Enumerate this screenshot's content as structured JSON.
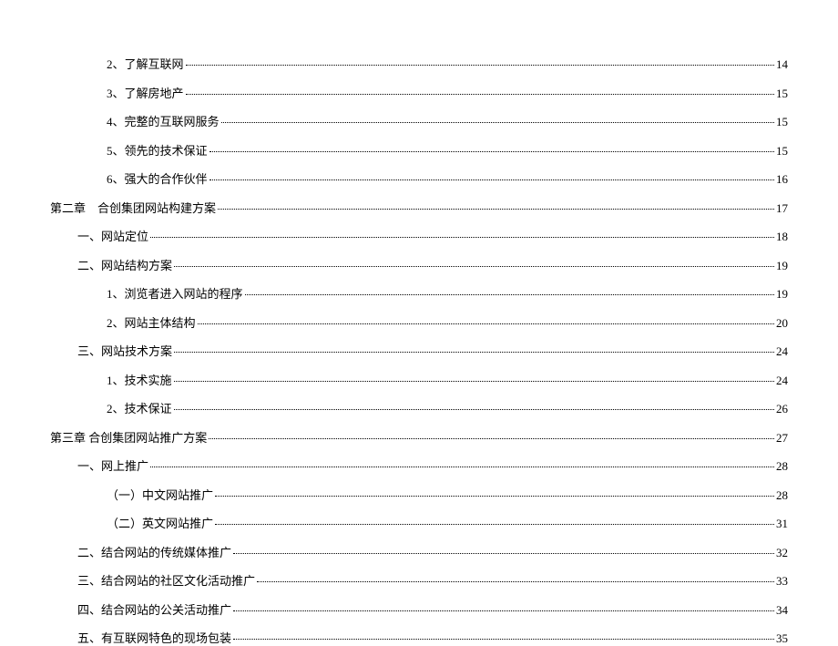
{
  "toc": [
    {
      "label": "2、了解互联网",
      "page": "14",
      "indent": 3
    },
    {
      "label": "3、了解房地产",
      "page": "15",
      "indent": 3
    },
    {
      "label": "4、完整的互联网服务",
      "page": "15",
      "indent": 3
    },
    {
      "label": "5、领先的技术保证",
      "page": "15",
      "indent": 3
    },
    {
      "label": "6、强大的合作伙伴",
      "page": "16",
      "indent": 3
    },
    {
      "label": "第二章　合创集团网站构建方案",
      "page": "17",
      "indent": 1
    },
    {
      "label": "一、网站定位",
      "page": "18",
      "indent": 2
    },
    {
      "label": "二、网站结构方案",
      "page": "19",
      "indent": 2
    },
    {
      "label": "1、浏览者进入网站的程序",
      "page": "19",
      "indent": 3
    },
    {
      "label": "2、网站主体结构",
      "page": "20",
      "indent": 3
    },
    {
      "label": "三、网站技术方案",
      "page": "24",
      "indent": 2
    },
    {
      "label": "1、技术实施",
      "page": "24",
      "indent": 3
    },
    {
      "label": "2、技术保证",
      "page": "26",
      "indent": 3
    },
    {
      "label": "第三章 合创集团网站推广方案",
      "page": "27",
      "indent": 1
    },
    {
      "label": "一、网上推广",
      "page": "28",
      "indent": 2
    },
    {
      "label": "（一）中文网站推广",
      "page": "28",
      "indent": 3
    },
    {
      "label": "（二）英文网站推广",
      "page": "31",
      "indent": 3
    },
    {
      "label": "二、结合网站的传统媒体推广",
      "page": "32",
      "indent": 2
    },
    {
      "label": "三、结合网站的社区文化活动推广",
      "page": "33",
      "indent": 2
    },
    {
      "label": "四、结合网站的公关活动推广",
      "page": "34",
      "indent": 2
    },
    {
      "label": "五、有互联网特色的现场包装",
      "page": "35",
      "indent": 2
    }
  ]
}
